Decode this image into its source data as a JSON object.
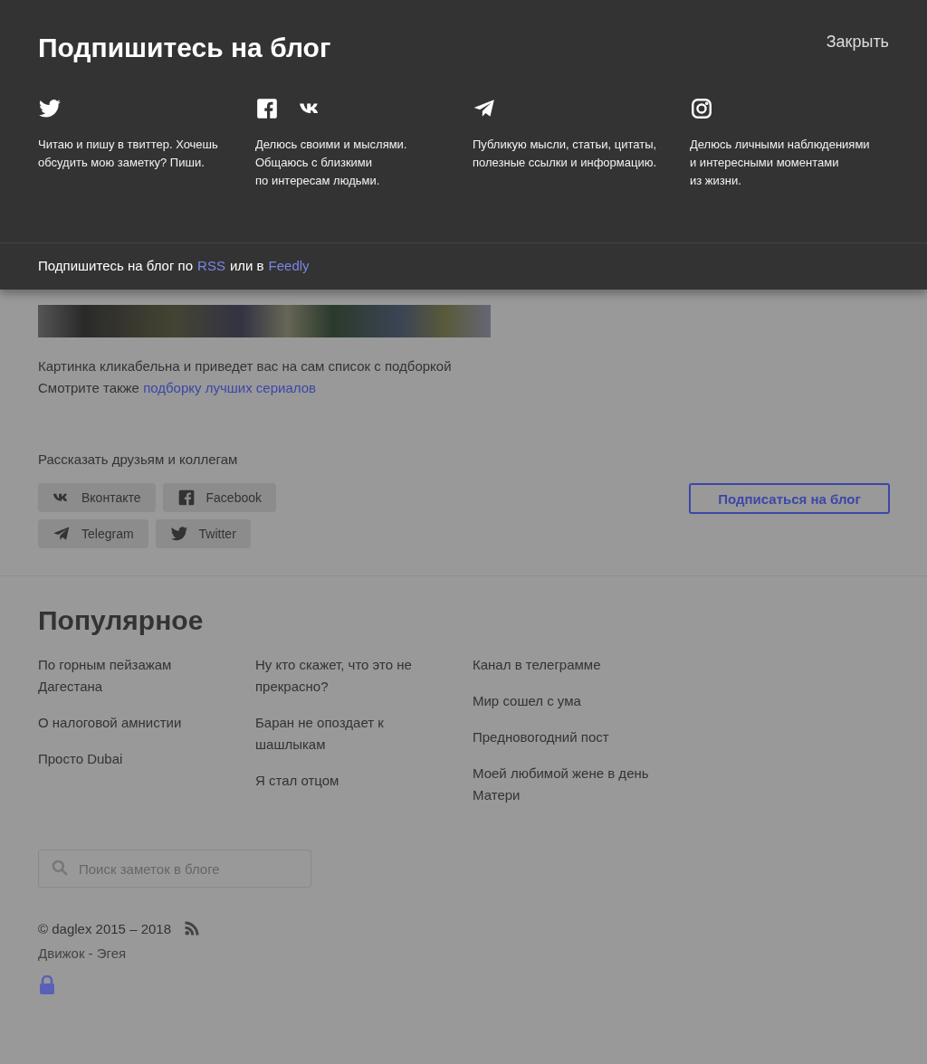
{
  "modal": {
    "title": "Подпишитесь на блог",
    "close": "Закрыть",
    "channels": [
      {
        "icons": [
          {
            "kind": "twitter"
          }
        ],
        "text": "Читаю и пишу в твиттер. Хочешь\nобсудить мою заметку? Пиши."
      },
      {
        "icons": [
          {
            "kind": "facebook"
          },
          {
            "kind": "vk"
          }
        ],
        "text": "Делюсь своими и мыслями.\nОбщаюсь с близкими\nпо интересам людьми."
      },
      {
        "icons": [
          {
            "kind": "telegram"
          }
        ],
        "text": "Публикую мысли, статьи, цитаты,\nполезные ссылки и информацию."
      },
      {
        "icons": [
          {
            "kind": "instagram"
          }
        ],
        "text": "Делюсь личными наблюдениями\nи интересными моментами\nиз жизни."
      }
    ],
    "footer": {
      "prefix": "Подпишитесь на блог по",
      "link1": "RSS",
      "middle": "или в",
      "link2": "Feedly"
    }
  },
  "article": {
    "caption": "Картинка кликабельна и приведет вас на сам список с подборкой",
    "see_also": "Смотрите также",
    "see_also_link": "подборку лучших сериалов"
  },
  "share": {
    "title": "Рассказать друзьям и коллегам",
    "buttons": [
      {
        "kind": "vk",
        "label": "Вконтакте"
      },
      {
        "kind": "facebook",
        "label": "Facebook"
      },
      {
        "kind": "telegram",
        "label": "Telegram"
      },
      {
        "kind": "twitter",
        "label": "Twitter"
      }
    ],
    "subscribe": "Подписаться на блог"
  },
  "popular": {
    "title": "Популярное",
    "columns": [
      [
        "По горным пейзажам Дагестана",
        "О налоговой амнистии",
        "Просто Dubai"
      ],
      [
        "Ну кто скажет, что это не прекрасно?",
        "Баран не опоздает к шашлыкам",
        "Я стал отцом"
      ],
      [
        "Канал в телеграмме",
        "Мир сошел с ума",
        "Предновогодний пост",
        "Моей любимой жене в день Матери"
      ]
    ]
  },
  "search": {
    "placeholder": "Поиск заметок в блоге"
  },
  "footer": {
    "copyright": "© daglex 2015 – 2018",
    "engine": "Движок - Эгея"
  }
}
